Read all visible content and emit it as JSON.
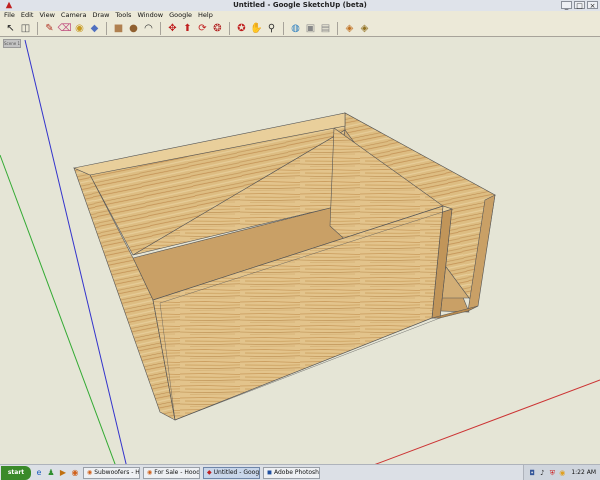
{
  "window": {
    "title": "Untitled - Google SketchUp (beta)"
  },
  "menu": [
    "File",
    "Edit",
    "View",
    "Camera",
    "Draw",
    "Tools",
    "Window",
    "Google",
    "Help"
  ],
  "toolbar": [
    {
      "name": "select-tool-icon",
      "glyph": "↖",
      "color": "#222222"
    },
    {
      "name": "component-tool-icon",
      "glyph": "◫",
      "color": "#555555"
    },
    {
      "name": "sep"
    },
    {
      "name": "line-tool-icon",
      "glyph": "✎",
      "color": "#b03020"
    },
    {
      "name": "eraser-tool-icon",
      "glyph": "⌫",
      "color": "#c05080"
    },
    {
      "name": "tape-measure-icon",
      "glyph": "◉",
      "color": "#c89a20"
    },
    {
      "name": "paint-bucket-icon",
      "glyph": "◆",
      "color": "#5070c0"
    },
    {
      "name": "sep"
    },
    {
      "name": "rectangle-tool-icon",
      "glyph": "■",
      "color": "#b08050"
    },
    {
      "name": "circle-tool-icon",
      "glyph": "●",
      "color": "#906030"
    },
    {
      "name": "arc-tool-icon",
      "glyph": "◠",
      "color": "#333333"
    },
    {
      "name": "sep"
    },
    {
      "name": "move-tool-icon",
      "glyph": "✥",
      "color": "#c02020"
    },
    {
      "name": "push-pull-icon",
      "glyph": "⬆",
      "color": "#c02020"
    },
    {
      "name": "rotate-tool-icon",
      "glyph": "⟳",
      "color": "#c02020"
    },
    {
      "name": "follow-me-icon",
      "glyph": "❂",
      "color": "#b02020"
    },
    {
      "name": "sep"
    },
    {
      "name": "orbit-icon",
      "glyph": "✪",
      "color": "#c02020"
    },
    {
      "name": "pan-icon",
      "glyph": "✋",
      "color": "#444444"
    },
    {
      "name": "zoom-icon",
      "glyph": "⚲",
      "color": "#333333"
    },
    {
      "name": "sep"
    },
    {
      "name": "google-earth-icon",
      "glyph": "◍",
      "color": "#2d7fc0"
    },
    {
      "name": "get-current-view-icon",
      "glyph": "▣",
      "color": "#888888"
    },
    {
      "name": "place-model-icon",
      "glyph": "▤",
      "color": "#888888"
    },
    {
      "name": "sep"
    },
    {
      "name": "get-models-icon",
      "glyph": "◈",
      "color": "#c07020"
    },
    {
      "name": "share-model-icon",
      "glyph": "◈",
      "color": "#907020"
    }
  ],
  "scene_tab": "Scene 1",
  "taskbar": {
    "start_label": "start",
    "quick_launch": [
      {
        "name": "ie-icon",
        "glyph": "e",
        "color": "#1f5fbf"
      },
      {
        "name": "messenger-icon",
        "glyph": "♟",
        "color": "#2f8f2f"
      },
      {
        "name": "media-player-icon",
        "glyph": "▶",
        "color": "#c07010"
      },
      {
        "name": "firefox-icon",
        "glyph": "◉",
        "color": "#d0601a"
      }
    ],
    "tasks": [
      {
        "label": "Subwoofers - Hood Co...",
        "active": false,
        "icon": "firefox-icon",
        "glyph": "◉",
        "color": "#d0601a"
      },
      {
        "label": "For Sale - Hood County...",
        "active": false,
        "icon": "firefox-icon",
        "glyph": "◉",
        "color": "#d0601a"
      },
      {
        "label": "Untitled - Google Sketc...",
        "active": true,
        "icon": "sketchup-icon",
        "glyph": "◆",
        "color": "#c02020"
      },
      {
        "label": "Adobe Photoshop",
        "active": false,
        "icon": "photoshop-icon",
        "glyph": "◼",
        "color": "#2050a0"
      }
    ],
    "tray_icons": [
      {
        "name": "network-icon",
        "glyph": "◘",
        "color": "#335599"
      },
      {
        "name": "volume-icon",
        "glyph": "♪",
        "color": "#333333"
      },
      {
        "name": "security-icon",
        "glyph": "⛨",
        "color": "#cc2222"
      },
      {
        "name": "updates-icon",
        "glyph": "◉",
        "color": "#e0a020"
      }
    ],
    "clock": "1:22 AM"
  },
  "colors": {
    "canvas": "#e5e5d6",
    "wood_light": "#e3c48c",
    "wood_dark": "#c99a5a",
    "axis_blue": "#3333cc",
    "axis_green": "#33aa33",
    "axis_red": "#cc3333"
  }
}
